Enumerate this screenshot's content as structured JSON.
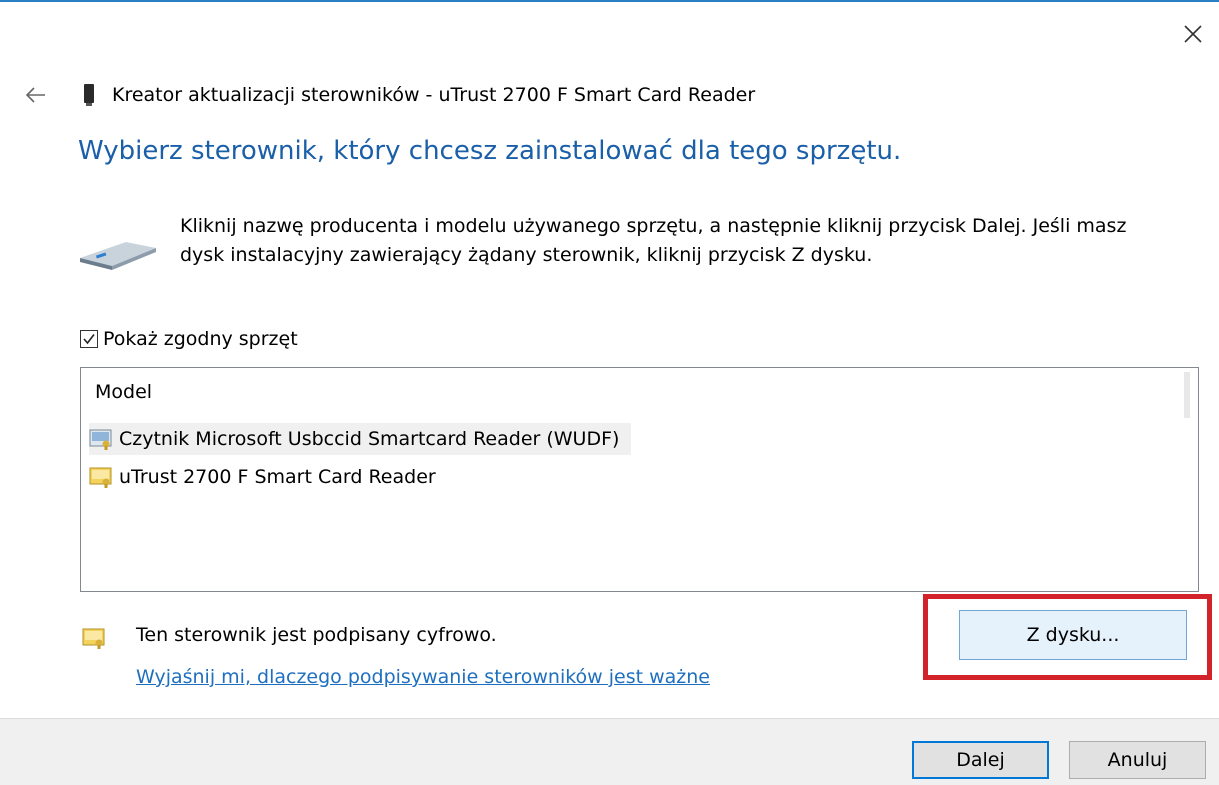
{
  "window": {
    "title": "Kreator aktualizacji sterowników - uTrust 2700 F Smart Card Reader",
    "accent_color": "#2b7fc4"
  },
  "heading": "Wybierz sterownik, który chcesz zainstalować dla tego sprzętu.",
  "instruction": "Kliknij nazwę producenta i modelu używanego sprzętu, a następnie kliknij przycisk Dalej. Jeśli masz dysk instalacyjny zawierający żądany sterownik, kliknij przycisk Z dysku.",
  "compatible_checkbox": {
    "label": "Pokaż zgodny sprzęt",
    "checked": true
  },
  "model_list": {
    "header": "Model",
    "items": [
      {
        "label": "Czytnik Microsoft Usbccid Smartcard Reader (WUDF)",
        "icon": "driver-certificate-icon",
        "selected": true
      },
      {
        "label": "uTrust 2700 F Smart Card Reader",
        "icon": "driver-certificate-icon",
        "selected": false
      }
    ]
  },
  "signature": {
    "text": "Ten sterownik jest podpisany cyfrowo.",
    "link": "Wyjaśnij mi, dlaczego podpisywanie sterowników jest ważne",
    "link_color": "#1e6fbf"
  },
  "have_disk_button": {
    "label": "Z dysku..."
  },
  "highlight_color": "#d2232a",
  "footer": {
    "next_label": "Dalej",
    "cancel_label": "Anuluj"
  }
}
